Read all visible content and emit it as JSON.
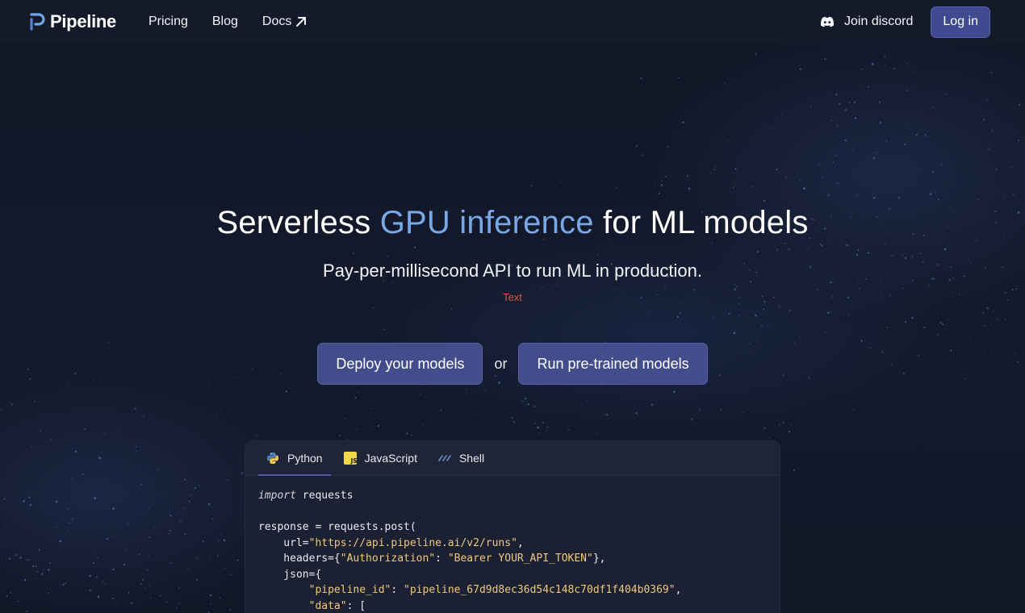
{
  "nav": {
    "brand": "Pipeline",
    "links": [
      {
        "label": "Pricing"
      },
      {
        "label": "Blog"
      },
      {
        "label": "Docs"
      }
    ],
    "discord_label": "Join discord",
    "login_label": "Log in"
  },
  "hero": {
    "headline_pre": "Serverless ",
    "headline_accent": "GPU inference",
    "headline_post": " for ML models",
    "subtitle": "Pay-per-millisecond API to run ML in production.",
    "note": "Text",
    "cta_primary": "Deploy your models",
    "cta_or": "or",
    "cta_secondary": "Run pre-trained models"
  },
  "code": {
    "tabs": [
      {
        "label": "Python",
        "icon": "python-icon",
        "active": true
      },
      {
        "label": "JavaScript",
        "icon": "javascript-icon",
        "active": false
      },
      {
        "label": "Shell",
        "icon": "shell-icon",
        "active": false
      }
    ],
    "lines": {
      "l1_kw": "import",
      "l1_rest": " requests",
      "l3": "response = requests.post(",
      "l4_pre": "    url=",
      "l4_str": "\"https://api.pipeline.ai/v2/runs\"",
      "l4_post": ",",
      "l5_pre": "    headers={",
      "l5_key": "\"Authorization\"",
      "l5_mid": ": ",
      "l5_val": "\"Bearer YOUR_API_TOKEN\"",
      "l5_post": "},",
      "l6": "    json={",
      "l7_pre": "        ",
      "l7_key": "\"pipeline_id\"",
      "l7_mid": ": ",
      "l7_val": "\"pipeline_67d9d8ec36d54c148c70df1f404b0369\"",
      "l7_post": ",",
      "l8_pre": "        ",
      "l8_key": "\"data\"",
      "l8_post": ": ["
    }
  },
  "colors": {
    "background": "#121727",
    "nav": "#151a2b",
    "accent": "#78a9e6",
    "button": "#444d8c",
    "code_string": "#f0c87c"
  }
}
